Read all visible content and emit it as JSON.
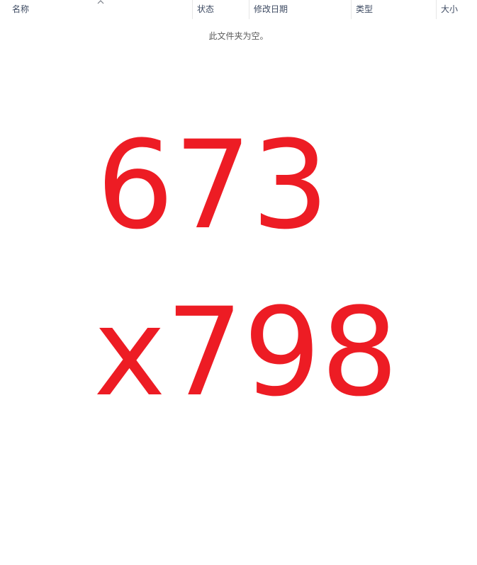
{
  "columns": {
    "name": "名称",
    "status": "状态",
    "modified_date": "修改日期",
    "type": "类型",
    "size": "大小"
  },
  "empty_message": "此文件夹为空。",
  "placeholder_image": {
    "width_text": "673",
    "height_text": "x798",
    "color": "#ed1c24"
  },
  "icons": {
    "sort": "chevron-up-icon"
  }
}
